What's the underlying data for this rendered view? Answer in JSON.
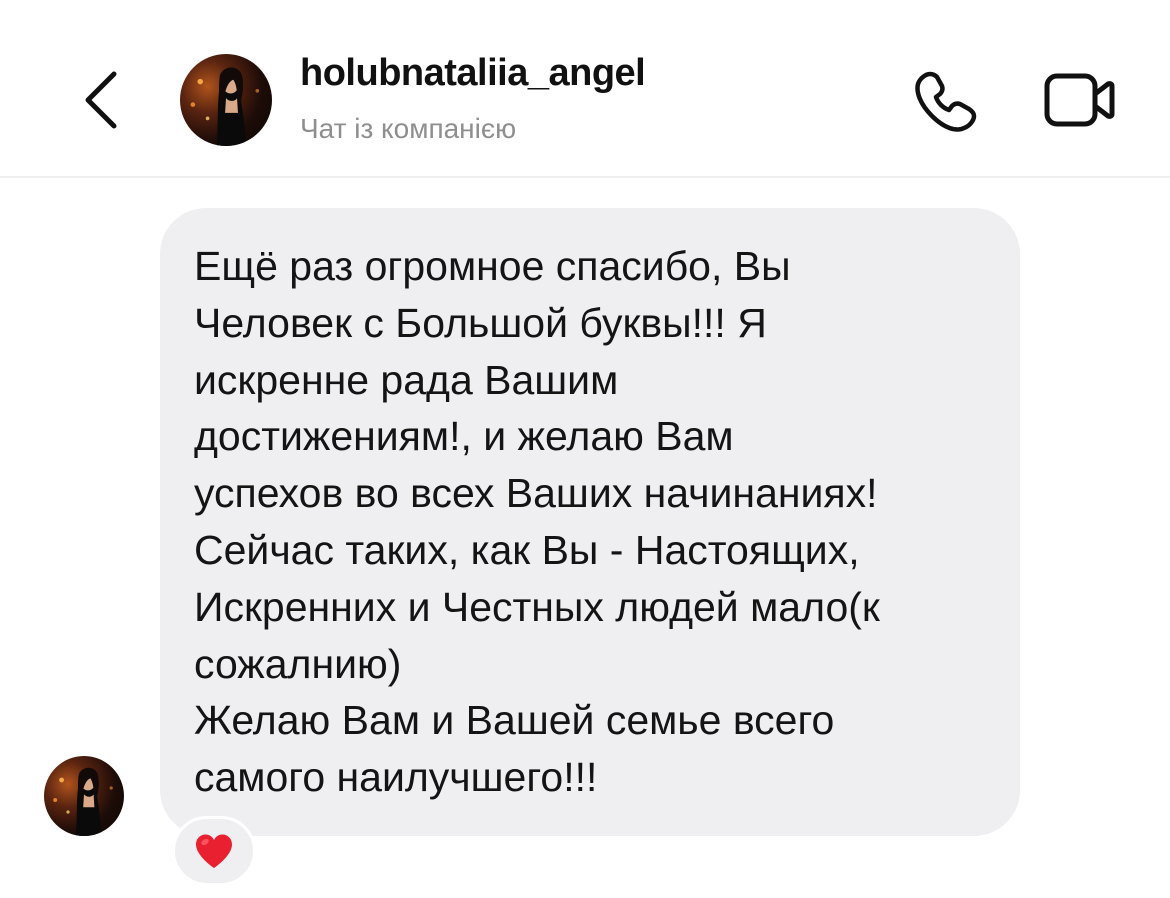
{
  "header": {
    "username": "holubnataliia_angel",
    "subtitle": "Чат із компанією",
    "back_icon": "chevron-left-icon",
    "call_icon": "phone-icon",
    "video_icon": "video-camera-icon"
  },
  "message": {
    "text": "Ещё раз огромное спасибо, Вы\nЧеловек с Большой буквы!!! Я\nискренне рада Вашим\nдостижениям!, и желаю Вам\nуспехов во всех Ваших начинаниях!\nСейчас таких, как Вы - Настоящих,\nИскренних и Честных людей мало(к\nсожалнию)\nЖелаю Вам и Вашей семье всего\nсамого наилучшего!!!",
    "reaction": "❤️",
    "reaction_icon": "red-heart-icon"
  },
  "colors": {
    "bubble": "#efeff1",
    "subtitle": "#8e8e8e",
    "heart": "#e8202f",
    "divider": "#efefef"
  }
}
